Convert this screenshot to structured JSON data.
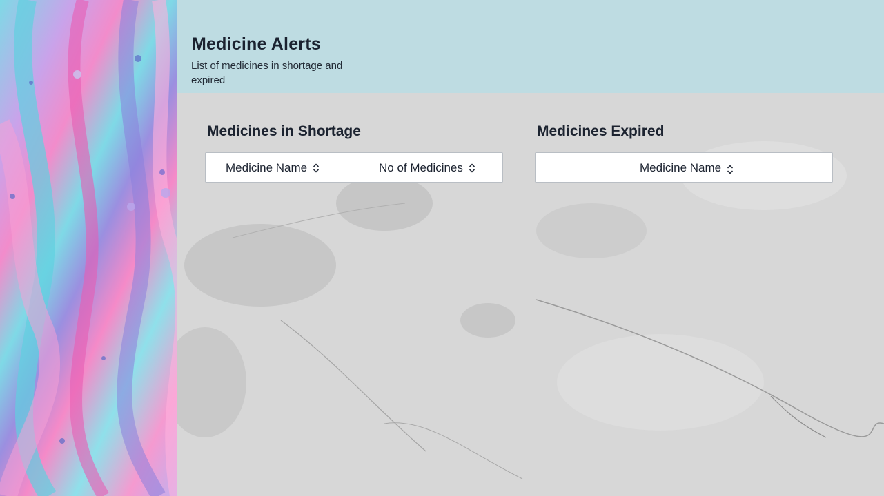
{
  "header": {
    "title": "Medicine Alerts",
    "subtitle": "List of medicines in shortage and expired"
  },
  "shortage": {
    "title": "Medicines in Shortage",
    "columns": [
      "Medicine Name",
      "No of Medicines"
    ]
  },
  "expired": {
    "title": "Medicines Expired",
    "columns": [
      "Medicine Name"
    ]
  },
  "icons": {
    "sort": "sort-icon"
  },
  "colors": {
    "header_bg": "#bedce2",
    "text": "#1c2330",
    "table_head_bg": "#ffffff"
  }
}
